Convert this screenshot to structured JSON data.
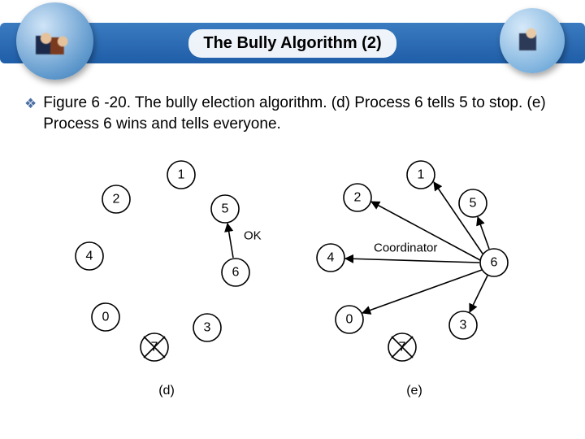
{
  "header": {
    "title": "The Bully Algorithm (2)"
  },
  "body": {
    "bullet_text": "Figure 6 -20. The bully election algorithm.  (d) Process 6 tells 5 to stop. (e) Process 6 wins and tells everyone."
  },
  "figure": {
    "d": {
      "nodes": {
        "n0": "0",
        "n1": "1",
        "n2": "2",
        "n3": "3",
        "n4": "4",
        "n5": "5",
        "n6": "6",
        "n7": "7"
      },
      "label": "(d)",
      "annotation": "OK"
    },
    "e": {
      "nodes": {
        "n0": "0",
        "n1": "1",
        "n2": "2",
        "n3": "3",
        "n4": "4",
        "n5": "5",
        "n6": "6",
        "n7": "7"
      },
      "label": "(e)",
      "annotation": "Coordinator"
    }
  }
}
